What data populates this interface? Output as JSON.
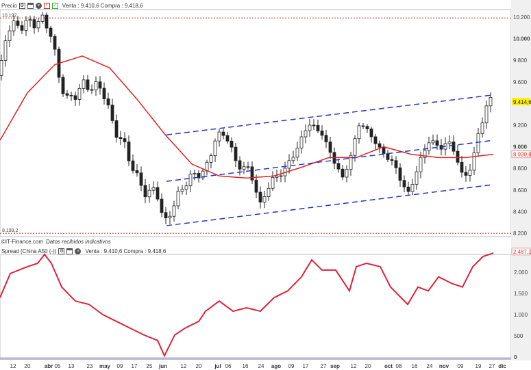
{
  "upper_header": {
    "title": "Precio",
    "quote": "Venta : 9.410,6 Compra : 9.418,6",
    "icons": [
      "wrench-icon",
      "window-icon",
      "close-circle-icon",
      "chart-icon",
      "check-icon"
    ]
  },
  "lower_header": {
    "title": "Spread (China A50 (-))",
    "quote": "Venta : 9.410,6 Compra : 9.418,6",
    "icons": [
      "wrench-icon",
      "window-icon",
      "close-circle-icon"
    ]
  },
  "source": {
    "name": "©IT-Finance.com",
    "note": "Datos recibidos indicativos"
  },
  "colors": {
    "ma": "#dd2222",
    "channel": "#2233cc",
    "spread": "#e0203a",
    "ref": "#cc2222",
    "price_badge": "#ffee00"
  },
  "chart_data": [
    {
      "type": "candlestick",
      "title": "Precio",
      "x_domain": [
        0,
        74.6
      ],
      "ylim": [
        8200,
        10200
      ],
      "yticks": [
        {
          "v": 10200,
          "label": "10.200"
        },
        {
          "v": 10000,
          "label": "10.000",
          "bold": true
        },
        {
          "v": 9800,
          "label": "9.800"
        },
        {
          "v": 9600,
          "label": "9.600"
        },
        {
          "v": 9200,
          "label": "9.200"
        },
        {
          "v": 9000,
          "label": "9.000",
          "bold": true
        },
        {
          "v": 8800,
          "label": "8.800"
        },
        {
          "v": 8600,
          "label": "8.600"
        },
        {
          "v": 8400,
          "label": "8.400"
        },
        {
          "v": 8200,
          "label": "8.200"
        }
      ],
      "last_price": {
        "v": 9414.6,
        "label": "9.414,6"
      },
      "ma_last": {
        "v": 8930.6,
        "label": "8.930,6"
      },
      "ref_lines": [
        {
          "v": 10192,
          "label": "10.192"
        },
        {
          "v": 8199.2,
          "label": "8.199,2"
        }
      ],
      "close_keypoints": [
        [
          0,
          9660
        ],
        [
          1,
          10100
        ],
        [
          4,
          10140
        ],
        [
          6.5,
          10170
        ],
        [
          7.5,
          10040
        ],
        [
          8.5,
          9660
        ],
        [
          10,
          9410
        ],
        [
          12,
          9570
        ],
        [
          15,
          9540
        ],
        [
          16.5,
          9190
        ],
        [
          18,
          9030
        ],
        [
          20,
          8710
        ],
        [
          21.5,
          8550
        ],
        [
          22.8,
          8620
        ],
        [
          24,
          8270
        ],
        [
          25.5,
          8490
        ],
        [
          27.5,
          8710
        ],
        [
          30,
          8780
        ],
        [
          31.5,
          9090
        ],
        [
          33,
          9120
        ],
        [
          34.5,
          8840
        ],
        [
          36.5,
          8780
        ],
        [
          38,
          8460
        ],
        [
          39.5,
          8680
        ],
        [
          41.5,
          8780
        ],
        [
          43.5,
          9000
        ],
        [
          45,
          9220
        ],
        [
          47,
          9120
        ],
        [
          48.5,
          8900
        ],
        [
          50,
          8710
        ],
        [
          51,
          8870
        ],
        [
          52.5,
          9230
        ],
        [
          54,
          9120
        ],
        [
          55.5,
          8970
        ],
        [
          57.5,
          8840
        ],
        [
          59.5,
          8550
        ],
        [
          61,
          8810
        ],
        [
          62.5,
          9060
        ],
        [
          64,
          9000
        ],
        [
          66,
          9030
        ],
        [
          67.5,
          8710
        ],
        [
          69,
          8840
        ],
        [
          70,
          9190
        ],
        [
          71.5,
          9440
        ],
        [
          72,
          9410
        ]
      ],
      "moving_average": [
        [
          0,
          9060
        ],
        [
          4,
          9500
        ],
        [
          8,
          9760
        ],
        [
          12,
          9840
        ],
        [
          16,
          9730
        ],
        [
          20,
          9440
        ],
        [
          24,
          9120
        ],
        [
          28,
          8840
        ],
        [
          32,
          8730
        ],
        [
          36,
          8710
        ],
        [
          40,
          8730
        ],
        [
          44,
          8810
        ],
        [
          48,
          8900
        ],
        [
          52,
          8900
        ],
        [
          56,
          9000
        ],
        [
          60,
          8930
        ],
        [
          64,
          8900
        ],
        [
          68,
          8900
        ],
        [
          72,
          8930
        ]
      ],
      "channel": {
        "upper": [
          [
            24.3,
            9110
          ],
          [
            72,
            9480
          ]
        ],
        "middle": [
          [
            24.3,
            8680
          ],
          [
            72,
            9060
          ]
        ],
        "lower": [
          [
            24.3,
            8270
          ],
          [
            72,
            8650
          ]
        ]
      }
    },
    {
      "type": "line",
      "title": "Spread (China A50 (-))",
      "x_domain": [
        0,
        74.6
      ],
      "ylim": [
        0,
        2500
      ],
      "yticks": [
        {
          "v": 2000,
          "label": "2.000"
        },
        {
          "v": 1500,
          "label": "1.500"
        },
        {
          "v": 1000,
          "label": "1.000"
        },
        {
          "v": 500,
          "label": "500"
        },
        {
          "v": 0,
          "label": "0",
          "bold": true
        }
      ],
      "last_value": {
        "v": 2487.1,
        "label": "2.487,1"
      },
      "values": [
        [
          0,
          1400
        ],
        [
          1.5,
          1970
        ],
        [
          4,
          2130
        ],
        [
          5.5,
          2210
        ],
        [
          6.5,
          2420
        ],
        [
          7.5,
          2210
        ],
        [
          9,
          1650
        ],
        [
          11,
          1320
        ],
        [
          13,
          1240
        ],
        [
          15,
          1000
        ],
        [
          17,
          840
        ],
        [
          19,
          680
        ],
        [
          21,
          520
        ],
        [
          23,
          390
        ],
        [
          24,
          30
        ],
        [
          25.5,
          520
        ],
        [
          27,
          680
        ],
        [
          29,
          840
        ],
        [
          30,
          1080
        ],
        [
          32,
          1320
        ],
        [
          34,
          1080
        ],
        [
          36,
          1160
        ],
        [
          38,
          1080
        ],
        [
          40,
          1400
        ],
        [
          42,
          1560
        ],
        [
          44,
          1890
        ],
        [
          45.5,
          2290
        ],
        [
          47,
          2050
        ],
        [
          49,
          2050
        ],
        [
          51,
          1560
        ],
        [
          52,
          2130
        ],
        [
          53.5,
          2210
        ],
        [
          55.5,
          2130
        ],
        [
          57,
          1650
        ],
        [
          59.5,
          1240
        ],
        [
          61,
          1650
        ],
        [
          62.5,
          1560
        ],
        [
          64,
          1890
        ],
        [
          66,
          1730
        ],
        [
          67.5,
          1650
        ],
        [
          69,
          2130
        ],
        [
          70.5,
          2370
        ],
        [
          72,
          2450
        ]
      ]
    }
  ],
  "x_ticks": [
    {
      "x": 1.9,
      "label": "12"
    },
    {
      "x": 4,
      "label": "20"
    },
    {
      "x": 7.1,
      "label": "abr",
      "bold": true
    },
    {
      "x": 8.4,
      "label": "05"
    },
    {
      "x": 10.4,
      "label": "13"
    },
    {
      "x": 13.1,
      "label": "23"
    },
    {
      "x": 15.3,
      "label": "may",
      "bold": true
    },
    {
      "x": 17.5,
      "label": "09"
    },
    {
      "x": 19.6,
      "label": "17"
    },
    {
      "x": 21.8,
      "label": "25"
    },
    {
      "x": 23.8,
      "label": "jun",
      "bold": true
    },
    {
      "x": 26.8,
      "label": "12"
    },
    {
      "x": 29,
      "label": "20"
    },
    {
      "x": 31.8,
      "label": "jul",
      "bold": true
    },
    {
      "x": 33.3,
      "label": "06"
    },
    {
      "x": 35.8,
      "label": "16"
    },
    {
      "x": 38.1,
      "label": "24"
    },
    {
      "x": 40.3,
      "label": "ago",
      "bold": true
    },
    {
      "x": 42.5,
      "label": "09"
    },
    {
      "x": 44.6,
      "label": "17"
    },
    {
      "x": 47.2,
      "label": "27"
    },
    {
      "x": 48.9,
      "label": "sep",
      "bold": true
    },
    {
      "x": 51.6,
      "label": "12"
    },
    {
      "x": 53.7,
      "label": "20"
    },
    {
      "x": 56.7,
      "label": "oct",
      "bold": true
    },
    {
      "x": 58.2,
      "label": "08"
    },
    {
      "x": 60.5,
      "label": "16"
    },
    {
      "x": 62.7,
      "label": "24"
    },
    {
      "x": 64.8,
      "label": "nov",
      "bold": true
    },
    {
      "x": 67.2,
      "label": "09"
    },
    {
      "x": 69.8,
      "label": "19"
    },
    {
      "x": 71.8,
      "label": "27"
    },
    {
      "x": 73.3,
      "label": "dic",
      "bold": true
    }
  ]
}
